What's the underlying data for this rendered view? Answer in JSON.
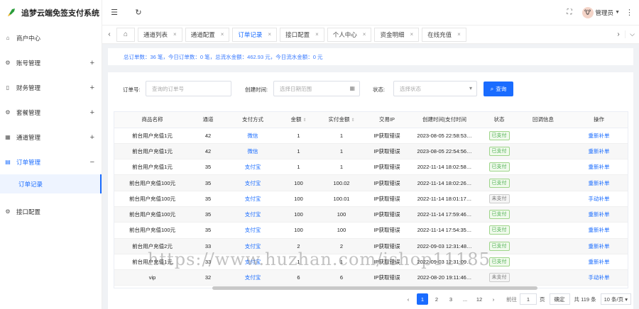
{
  "app": {
    "title": "追梦云端免签支付系统"
  },
  "sidebar": {
    "items": [
      {
        "label": "商户中心",
        "icon": "home-icon",
        "expand": ""
      },
      {
        "label": "账号管理",
        "icon": "gear-icon",
        "expand": "+"
      },
      {
        "label": "财务管理",
        "icon": "book-icon",
        "expand": "+"
      },
      {
        "label": "套餐管理",
        "icon": "package-icon",
        "expand": "+"
      },
      {
        "label": "通道管理",
        "icon": "channel-icon",
        "expand": "+"
      },
      {
        "label": "订单管理",
        "icon": "order-icon",
        "expand": "−"
      }
    ],
    "subitem": "订单记录",
    "last_item": {
      "label": "接口配置",
      "icon": "api-icon"
    }
  },
  "topbar": {
    "user": "管理员"
  },
  "tabs": [
    {
      "label": "通道列表",
      "close": "×"
    },
    {
      "label": "通道配置",
      "close": "×"
    },
    {
      "label": "订单记录",
      "close": "×"
    },
    {
      "label": "接口配置",
      "close": "×"
    },
    {
      "label": "个人中心",
      "close": "×"
    },
    {
      "label": "资金明细",
      "close": "×"
    },
    {
      "label": "在线充值",
      "close": "×"
    }
  ],
  "stats": {
    "text": "总订单数：36 笔，今日订单数：0 笔，总流水金额：462.93 元，今日流水金额：0 元"
  },
  "search": {
    "order_label": "订单号:",
    "order_placeholder": "查询的订单号",
    "time_label": "创建时间:",
    "time_placeholder": "选择日期范围",
    "status_label": "状态:",
    "status_placeholder": "选择状态",
    "query_label": "查询"
  },
  "table": {
    "headers": [
      "商品名称",
      "通道",
      "支付方式",
      "金额",
      "实付金额",
      "交易IP",
      "创建时间|支付时间",
      "状态",
      "回调信息",
      "操作"
    ],
    "rows": [
      [
        "前台用户充值1元",
        "42",
        "微信",
        "1",
        "1",
        "IP获取错误",
        "2023-08-05 22:58:53…",
        "已支付",
        "",
        "重新补单"
      ],
      [
        "前台用户充值1元",
        "42",
        "微信",
        "1",
        "1",
        "IP获取错误",
        "2023-08-05 22:54:56…",
        "已支付",
        "",
        "重新补单"
      ],
      [
        "前台用户充值1元",
        "35",
        "支付宝",
        "1",
        "1",
        "IP获取错误",
        "2022-11-14 18:02:58…",
        "已支付",
        "",
        "重新补单"
      ],
      [
        "前台用户充值100元",
        "35",
        "支付宝",
        "100",
        "100.02",
        "IP获取错误",
        "2022-11-14 18:02:26…",
        "已支付",
        "",
        "重新补单"
      ],
      [
        "前台用户充值100元",
        "35",
        "支付宝",
        "100",
        "100.01",
        "IP获取错误",
        "2022-11-14 18:01:17…",
        "未支付",
        "",
        "手动补单"
      ],
      [
        "前台用户充值100元",
        "35",
        "支付宝",
        "100",
        "100",
        "IP获取错误",
        "2022-11-14 17:59:46…",
        "已支付",
        "",
        "重新补单"
      ],
      [
        "前台用户充值100元",
        "35",
        "支付宝",
        "100",
        "100",
        "IP获取错误",
        "2022-11-14 17:54:35…",
        "已支付",
        "",
        "重新补单"
      ],
      [
        "前台用户充值2元",
        "33",
        "支付宝",
        "2",
        "2",
        "IP获取错误",
        "2022-09-03 12:31:48…",
        "已支付",
        "",
        "重新补单"
      ],
      [
        "前台用户充值1元",
        "33",
        "支付宝",
        "1",
        "1",
        "IP获取错误",
        "2022-09-03 12:31:09…",
        "已支付",
        "",
        "重新补单"
      ],
      [
        "vip",
        "32",
        "支付宝",
        "6",
        "6",
        "IP获取错误",
        "2022-08-20 19:11:46…",
        "未支付",
        "",
        "手动补单"
      ]
    ]
  },
  "pager": {
    "pages": [
      "1",
      "2",
      "3",
      "...",
      "12"
    ],
    "jump_label": "前往",
    "jump_value": "1",
    "page_unit": "页",
    "confirm": "确定",
    "total": "共 119 条",
    "size": "10 条/页"
  },
  "watermark": "https://www.huzhan.com/ishop11185",
  "colors": {
    "accent": "#1a6cff",
    "paid": "#4caf50"
  }
}
